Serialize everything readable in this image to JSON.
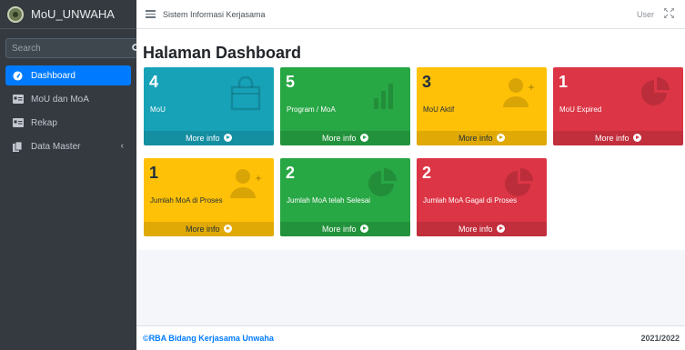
{
  "sidebar": {
    "brand": "MoU_UNWAHA",
    "search_placeholder": "Search",
    "items": [
      {
        "label": "Dashboard"
      },
      {
        "label": "MoU dan MoA"
      },
      {
        "label": "Rekap"
      },
      {
        "label": "Data Master"
      }
    ]
  },
  "header": {
    "title": "Sistem Informasi Kerjasama",
    "user": "User"
  },
  "main": {
    "page_title": "Halaman Dashboard",
    "more_info": "More info",
    "boxes": [
      {
        "count": "4",
        "label": "MoU",
        "color": "#17a2b8",
        "icon": "shopping-bag-icon"
      },
      {
        "count": "5",
        "label": "Program / MoA",
        "color": "#28a745",
        "icon": "bar-chart-icon"
      },
      {
        "count": "3",
        "label": "MoU Aktif",
        "color": "#ffc107",
        "icon": "user-plus-icon"
      },
      {
        "count": "1",
        "label": "MoU Expired",
        "color": "#dc3545",
        "icon": "pie-chart-icon"
      },
      {
        "count": "1",
        "label": "Jumlah MoA di Proses",
        "color": "#ffc107",
        "icon": "user-plus-icon"
      },
      {
        "count": "2",
        "label": "Jumlah MoA telah Selesai",
        "color": "#28a745",
        "icon": "pie-chart-icon"
      },
      {
        "count": "2",
        "label": "Jumlah MoA Gagal di Proses",
        "color": "#dc3545",
        "icon": "pie-chart-icon"
      }
    ]
  },
  "footer": {
    "copyright": "©RBA Bidang Kerjasama Unwaha",
    "year": "2021/2022"
  }
}
